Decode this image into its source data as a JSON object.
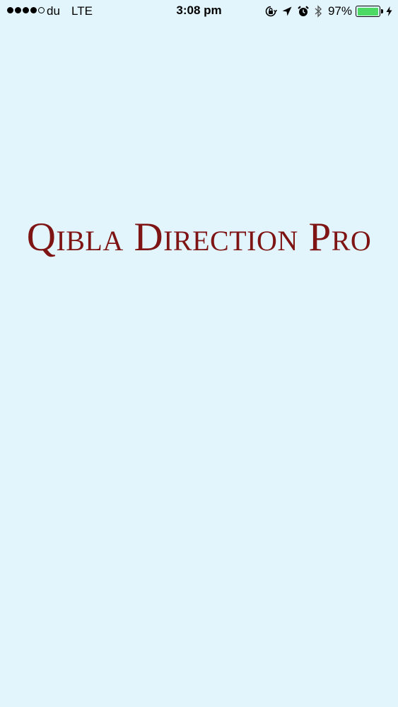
{
  "status_bar": {
    "carrier": "du",
    "network": "LTE",
    "time": "3:08 pm",
    "battery_percent": "97%",
    "battery_level": 0.97,
    "signal_bars_filled": 4,
    "signal_bars_total": 5,
    "icons": [
      "orientation-lock-icon",
      "location-arrow-icon",
      "alarm-icon",
      "bluetooth-icon",
      "battery-icon",
      "charging-bolt-icon"
    ],
    "battery_color": "#4cd964"
  },
  "splash": {
    "app_title": "Qibla Direction Pro",
    "title_color": "#7e1414",
    "background_color": "#e2f5fc"
  }
}
